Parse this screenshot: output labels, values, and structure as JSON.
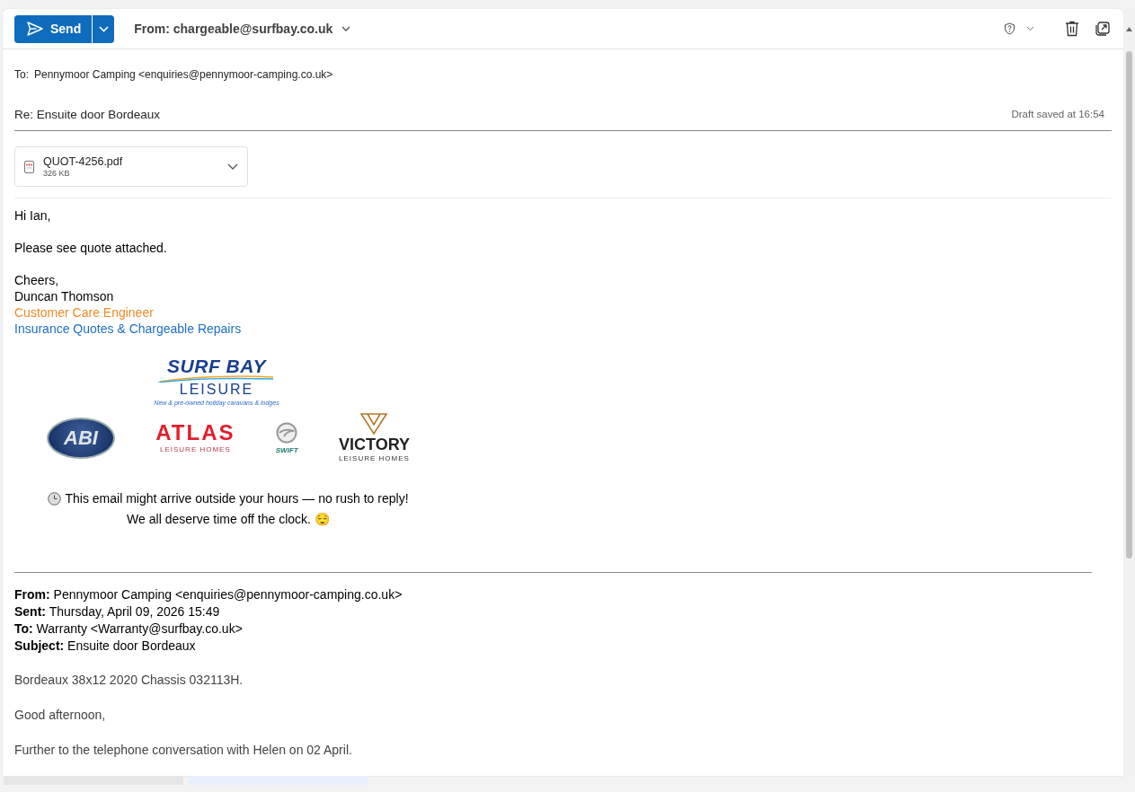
{
  "toolbar": {
    "send_label": "Send",
    "from": "From: chargeable@surfbay.co.uk"
  },
  "to": {
    "label": "To:",
    "recipient": "Pennymoor Camping <enquiries@pennymoor-camping.co.uk>"
  },
  "subject": "Re: Ensuite door Bordeaux",
  "draft_status": "Draft saved at 16:54",
  "attachment": {
    "name": "QUOT-4256.pdf",
    "size": "326 KB"
  },
  "body": {
    "greeting": "Hi Ian,",
    "paragraph": "Please see quote attached.",
    "signoff": "Cheers,",
    "name": "Duncan Thomson",
    "job_title": "Customer Care Engineer",
    "department": "Insurance Quotes & Chargeable Repairs"
  },
  "main_logo": {
    "name": "SURF BAY",
    "subname": "LEISURE",
    "tagline": "New & pre-owned holiday caravans & lodges"
  },
  "partner_logos": [
    {
      "kind": "abi",
      "name": "ABI"
    },
    {
      "kind": "atlas",
      "name": "ATLAS",
      "subname": "LEISURE HOMES"
    },
    {
      "kind": "swift",
      "name": "SWIFT"
    },
    {
      "kind": "victory",
      "name": "VICTORY",
      "subname": "LEISURE HOMES"
    }
  ],
  "notice": [
    "This email might arrive outside your hours — no rush to reply!",
    "We all deserve time off the clock. 😌"
  ],
  "quoted": {
    "headers": [
      {
        "label": "From:",
        "value": "Pennymoor Camping <enquiries@pennymoor-camping.co.uk>"
      },
      {
        "label": "Sent:",
        "value": "Thursday, April 09, 2026 15:49"
      },
      {
        "label": "To:",
        "value": "Warranty <Warranty@surfbay.co.uk>"
      },
      {
        "label": "Subject:",
        "value": "Ensuite door Bordeaux"
      }
    ],
    "paragraphs": [
      "Bordeaux 38x12 2020 Chassis 032113H.",
      "Good afternoon,",
      "Further to the telephone conversation with Helen on 02 April."
    ]
  }
}
